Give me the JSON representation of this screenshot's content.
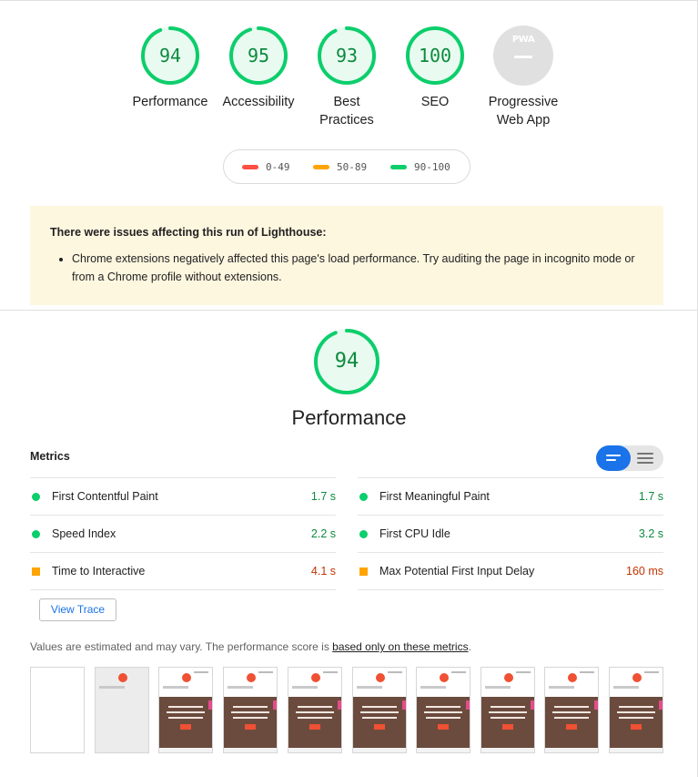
{
  "gauges": [
    {
      "score": "94",
      "label": "Performance",
      "value": 94,
      "color": "#0cce6b"
    },
    {
      "score": "95",
      "label": "Accessibility",
      "value": 95,
      "color": "#0cce6b"
    },
    {
      "score": "93",
      "label_line1": "Best",
      "label_line2": "Practices",
      "value": 93,
      "color": "#0cce6b"
    },
    {
      "score": "100",
      "label": "SEO",
      "value": 100,
      "color": "#0cce6b"
    }
  ],
  "pwa": {
    "badge_text": "PWA",
    "label_line1": "Progressive",
    "label_line2": "Web App"
  },
  "legend": [
    {
      "range": "0-49",
      "color": "#ff4e42"
    },
    {
      "range": "50-89",
      "color": "#ffa400"
    },
    {
      "range": "90-100",
      "color": "#0cce6b"
    }
  ],
  "warning": {
    "title": "There were issues affecting this run of Lighthouse:",
    "items": [
      "Chrome extensions negatively affected this page's load performance. Try auditing the page in incognito mode or from a Chrome profile without extensions."
    ]
  },
  "performance": {
    "score": "94",
    "value": 94,
    "title": "Performance"
  },
  "metrics": {
    "title": "Metrics",
    "left": [
      {
        "label": "First Contentful Paint",
        "value": "1.7 s",
        "status": "pass"
      },
      {
        "label": "Speed Index",
        "value": "2.2 s",
        "status": "pass"
      },
      {
        "label": "Time to Interactive",
        "value": "4.1 s",
        "status": "average"
      }
    ],
    "right": [
      {
        "label": "First Meaningful Paint",
        "value": "1.7 s",
        "status": "pass"
      },
      {
        "label": "First CPU Idle",
        "value": "3.2 s",
        "status": "pass"
      },
      {
        "label": "Max Potential First Input Delay",
        "value": "160 ms",
        "status": "average"
      }
    ]
  },
  "view_trace_label": "View Trace",
  "note": {
    "prefix": "Values are estimated and may vary. The performance score is ",
    "link": "based only on these metrics",
    "suffix": "."
  },
  "colors": {
    "pass": "#0cce6b",
    "average": "#ffa400",
    "fail": "#ff4e42",
    "accent": "#1a73e8",
    "warning_bg": "#fef7e0"
  }
}
